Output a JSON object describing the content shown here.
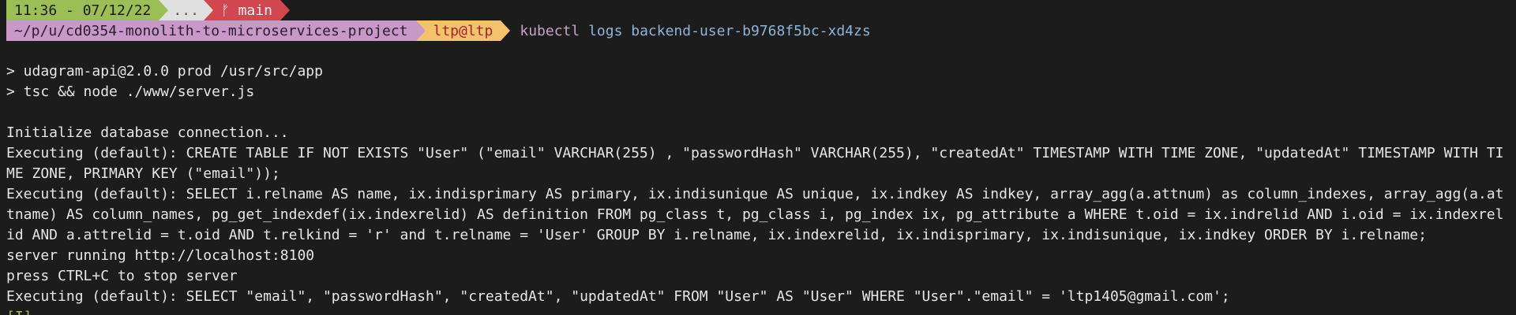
{
  "prompt1": {
    "time": "11:36 - 07/12/22",
    "dots": "...",
    "git_icon": "git-branch-icon",
    "git_glyph": "ᚠ",
    "branch": "main"
  },
  "prompt2": {
    "path": "~/p/u/cd0354-monolith-to-microservices-project",
    "user": "ltp@ltp",
    "cmd_name": "kubectl",
    "cmd_args": "logs backend-user-b9768f5bc-xd4zs"
  },
  "output": {
    "l1": "> udagram-api@2.0.0 prod /usr/src/app",
    "l2": "> tsc && node ./www/server.js",
    "l3": "Initialize database connection...",
    "l4": "Executing (default): CREATE TABLE IF NOT EXISTS \"User\" (\"email\" VARCHAR(255) , \"passwordHash\" VARCHAR(255), \"createdAt\" TIMESTAMP WITH TIME ZONE, \"updatedAt\" TIMESTAMP WITH TIME ZONE, PRIMARY KEY (\"email\"));",
    "l5": "Executing (default): SELECT i.relname AS name, ix.indisprimary AS primary, ix.indisunique AS unique, ix.indkey AS indkey, array_agg(a.attnum) as column_indexes, array_agg(a.attname) AS column_names, pg_get_indexdef(ix.indexrelid) AS definition FROM pg_class t, pg_class i, pg_index ix, pg_attribute a WHERE t.oid = ix.indrelid AND i.oid = ix.indexrelid AND a.attrelid = t.oid AND t.relkind = 'r' and t.relname = 'User' GROUP BY i.relname, ix.indexrelid, ix.indisprimary, ix.indisunique, ix.indkey ORDER BY i.relname;",
    "l6": "server running http://localhost:8100",
    "l7": "press CTRL+C to stop server",
    "l8": "Executing (default): SELECT \"email\", \"passwordHash\", \"createdAt\", \"updatedAt\" FROM \"User\" AS \"User\" WHERE \"User\".\"email\" = 'ltp1405@gmail.com';",
    "l9": "[I]"
  },
  "colors": {
    "background": "#1c1c1c",
    "time_segment": "#9bbf55",
    "git_segment": "#d2464f",
    "path_segment": "#c898c8",
    "user_segment": "#f4c26b"
  }
}
